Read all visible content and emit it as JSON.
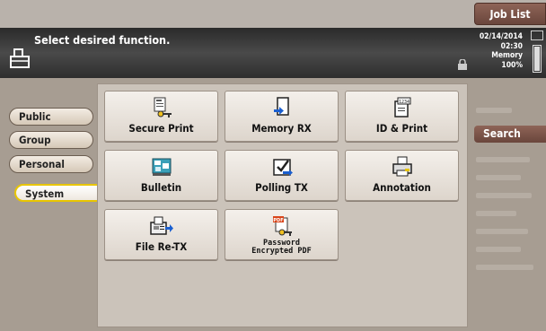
{
  "header": {
    "job_list_label": "Job List",
    "message": "Select desired function.",
    "date": "02/14/2014",
    "time": "02:30",
    "memory_label": "Memory",
    "memory_value": "100%"
  },
  "tabs": [
    {
      "label": "Public"
    },
    {
      "label": "Group"
    },
    {
      "label": "Personal"
    },
    {
      "label": "System",
      "active": true
    }
  ],
  "functions": [
    {
      "label": "Secure Print",
      "icon": "secure-print-icon"
    },
    {
      "label": "Memory RX",
      "icon": "memory-rx-icon"
    },
    {
      "label": "ID & Print",
      "icon": "id-print-icon"
    },
    {
      "label": "Bulletin",
      "icon": "bulletin-icon"
    },
    {
      "label": "Polling TX",
      "icon": "polling-tx-icon"
    },
    {
      "label": "Annotation",
      "icon": "annotation-icon"
    },
    {
      "label": "File Re-TX",
      "icon": "file-retx-icon"
    },
    {
      "label_line1": "Password",
      "label_line2": "Encrypted PDF",
      "icon": "encrypted-pdf-icon"
    }
  ],
  "side": {
    "search_label": "Search"
  },
  "colors": {
    "accent": "#e8c500",
    "brand": "#7a5245",
    "header_bg": "#333333"
  }
}
